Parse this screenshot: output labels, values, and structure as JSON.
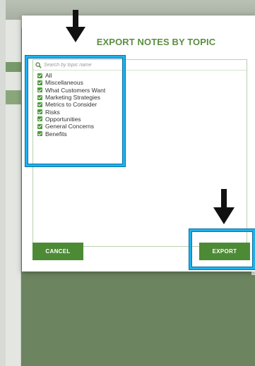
{
  "dialog": {
    "title": "EXPORT NOTES BY TOPIC"
  },
  "search": {
    "placeholder": "Search by topic name",
    "icon": "search-icon"
  },
  "topics": [
    {
      "label": "All",
      "checked": true
    },
    {
      "label": "Miscellaneous",
      "checked": true
    },
    {
      "label": "What Customers Want",
      "checked": true
    },
    {
      "label": "Marketing Strategies",
      "checked": true
    },
    {
      "label": "Metrics to Consider",
      "checked": true
    },
    {
      "label": "Risks",
      "checked": true
    },
    {
      "label": "Opportunities",
      "checked": true
    },
    {
      "label": "General Concerns",
      "checked": true
    },
    {
      "label": "Benefits",
      "checked": true
    }
  ],
  "buttons": {
    "cancel": "CANCEL",
    "export": "EXPORT"
  },
  "colors": {
    "accent_green": "#4d8a36",
    "title_green": "#5a8f3f",
    "highlight_blue": "#1bb3f0",
    "backdrop": "#6f8763"
  }
}
